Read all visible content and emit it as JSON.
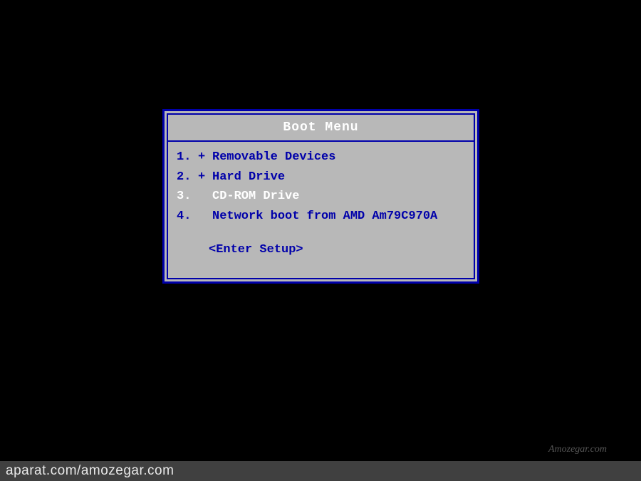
{
  "boot_menu": {
    "title": "Boot Menu",
    "items": [
      {
        "number": "1.",
        "prefix": "+",
        "label": "Removable Devices",
        "selected": false
      },
      {
        "number": "2.",
        "prefix": "+",
        "label": "Hard Drive",
        "selected": false
      },
      {
        "number": "3.",
        "prefix": "",
        "label": "CD-ROM Drive",
        "selected": true
      },
      {
        "number": "4.",
        "prefix": "",
        "label": "Network boot from AMD Am79C970A",
        "selected": false
      }
    ],
    "enter_setup": "<Enter Setup>"
  },
  "watermark_right": "Amozegar.com",
  "watermark_bottom": "aparat.com/amozegar.com"
}
